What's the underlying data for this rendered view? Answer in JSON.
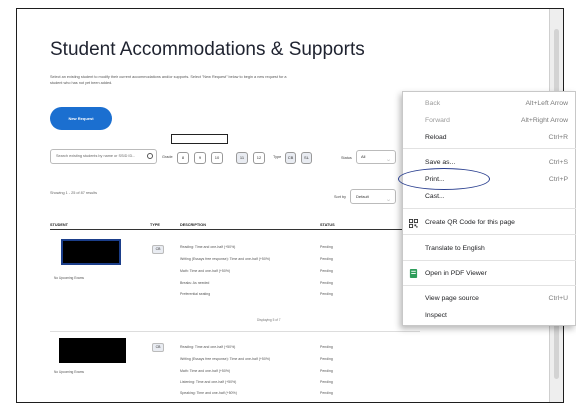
{
  "page": {
    "title": "Student Accommodations & Supports",
    "intro": "Select an existing student to modify their current accommodations and/or supports. Select \"New Request\" below to begin a new request for a student who has not yet been added.",
    "new_request_label": "New Request",
    "search_placeholder": "Search existing students by name or SSID ID...",
    "grade_label": "Grade",
    "grades": [
      "8",
      "9",
      "10",
      "11",
      "12"
    ],
    "type_label": "Type",
    "types": [
      "CB",
      "SL"
    ],
    "status_label": "Status",
    "status_value": "All",
    "showing": "Showing 1 - 25 of 87 results",
    "sort_label": "Sort by",
    "sort_value": "Default",
    "columns": {
      "student": "STUDENT",
      "type": "TYPE",
      "description": "DESCRIPTION",
      "status": "STATUS"
    },
    "rows": [
      {
        "upcoming": "No Upcoming Exams",
        "type": "CB",
        "descriptions": [
          "Reading: Time and one-half (+50%)",
          "Writing (Essays free response): Time and one-half (+50%)",
          "Math: Time and one-half (+50%)",
          "Breaks: As needed",
          "Preferential seating"
        ],
        "statuses": [
          "Pending",
          "Pending",
          "Pending",
          "Pending",
          "Pending"
        ],
        "displaying": "Displaying 5 of 7"
      },
      {
        "upcoming": "No Upcoming Exams",
        "type": "CB",
        "descriptions": [
          "Reading: Time and one-half (+50%)",
          "Writing (Essays free response): Time and one-half (+50%)",
          "Math: Time and one-half (+50%)",
          "Listening: Time and one-half (+50%)",
          "Speaking: Time and one-half (+50%)"
        ],
        "statuses": [
          "Pending",
          "Pending",
          "Pending",
          "Pending",
          "Pending"
        ]
      }
    ]
  },
  "context_menu": {
    "back": "Back",
    "back_shortcut": "Alt+Left Arrow",
    "forward": "Forward",
    "forward_shortcut": "Alt+Right Arrow",
    "reload": "Reload",
    "reload_shortcut": "Ctrl+R",
    "save_as": "Save as...",
    "save_as_shortcut": "Ctrl+S",
    "print": "Print...",
    "print_shortcut": "Ctrl+P",
    "cast": "Cast...",
    "qr": "Create QR Code for this page",
    "translate": "Translate to English",
    "pdf": "Open in PDF Viewer",
    "view_source": "View page source",
    "view_source_shortcut": "Ctrl+U",
    "inspect": "Inspect"
  },
  "colors": {
    "accent": "#1b6fd0",
    "highlight_ring": "#2a3f8f",
    "redaction": "#000000"
  }
}
